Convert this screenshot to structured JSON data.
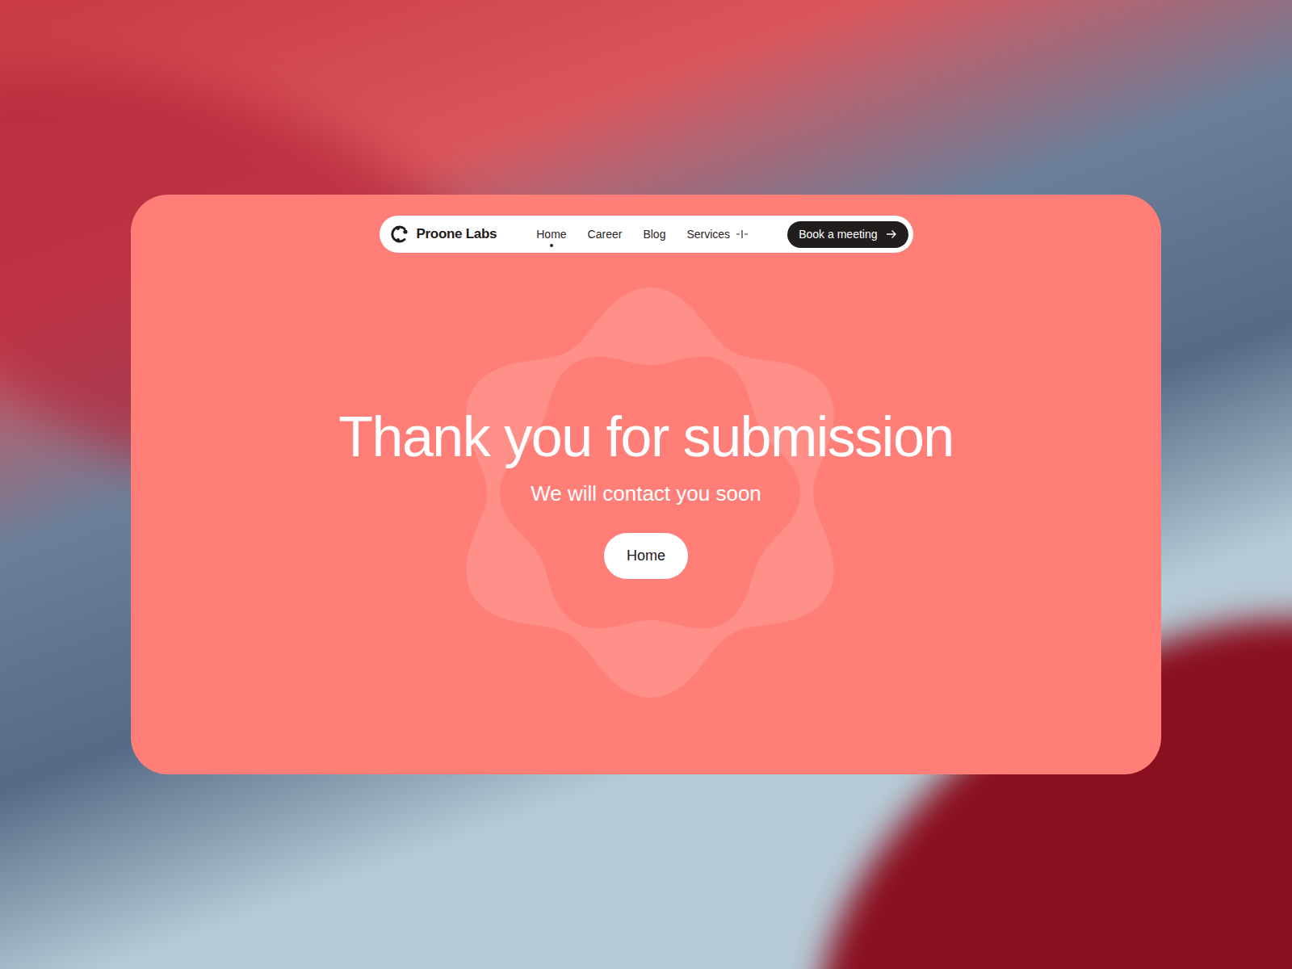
{
  "nav": {
    "brand": "Proone Labs",
    "links": [
      {
        "label": "Home",
        "selected": true
      },
      {
        "label": "Career",
        "selected": false
      },
      {
        "label": "Blog",
        "selected": false
      },
      {
        "label": "Services",
        "selected": false
      }
    ],
    "cta": "Book a meeting"
  },
  "hero": {
    "title": "Thank you for submission",
    "subtitle": "We will contact you soon",
    "button": "Home"
  }
}
